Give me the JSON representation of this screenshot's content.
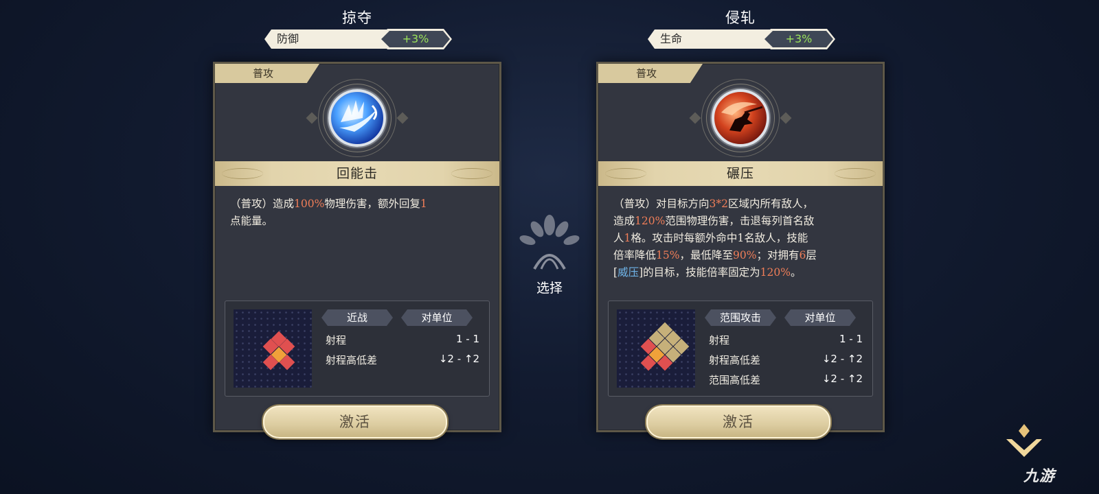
{
  "cards": [
    {
      "title": "掠夺",
      "stat_name": "防御",
      "stat_value": "+3%",
      "type_tag": "普攻",
      "icon": "sword-slash-icon",
      "skill_name": "回能击",
      "description_line1_parts": [
        "（普攻）造成",
        "100%",
        "物理伤害，额外回复",
        "1"
      ],
      "description_line2": "点能量。",
      "chips": [
        "近战",
        "对单位"
      ],
      "rows": [
        {
          "label": "射程",
          "value": "1 - 1"
        },
        {
          "label": "射程高低差",
          "value": "↓2 - ↑2"
        }
      ],
      "activate_label": "激活"
    },
    {
      "title": "侵轧",
      "stat_name": "生命",
      "stat_value": "+3%",
      "type_tag": "普攻",
      "icon": "rider-charge-icon",
      "skill_name": "碾压",
      "description_lines": [
        [
          "（普攻）对目标方向",
          "3*2",
          "区域内所有敌人，"
        ],
        [
          "造成",
          "120%",
          "范围物理伤害，击退每列首名敌"
        ],
        [
          "人",
          "1",
          "格。攻击时每额外命中1名敌人，技能"
        ],
        [
          "倍率降低",
          "15%",
          "，最低降至",
          "90%",
          "；对拥有",
          "6",
          "层"
        ],
        [
          "[",
          "威压",
          "]的目标，技能倍率固定为",
          "120%",
          "。"
        ]
      ],
      "chips": [
        "范围攻击",
        "对单位"
      ],
      "rows": [
        {
          "label": "射程",
          "value": "1 - 1"
        },
        {
          "label": "射程高低差",
          "value": "↓2 - ↑2"
        },
        {
          "label": "范围高低差",
          "value": "↓2 - ↑2"
        }
      ],
      "activate_label": "激活"
    }
  ],
  "center": {
    "select_label": "选择",
    "emblem_icon": "tree-leaves-icon"
  },
  "watermark": "九游",
  "colors": {
    "highlight_orange": "#f07e58",
    "highlight_blue": "#6fb4e8",
    "stat_green": "#9be35a",
    "gold": "#d8c99e"
  }
}
